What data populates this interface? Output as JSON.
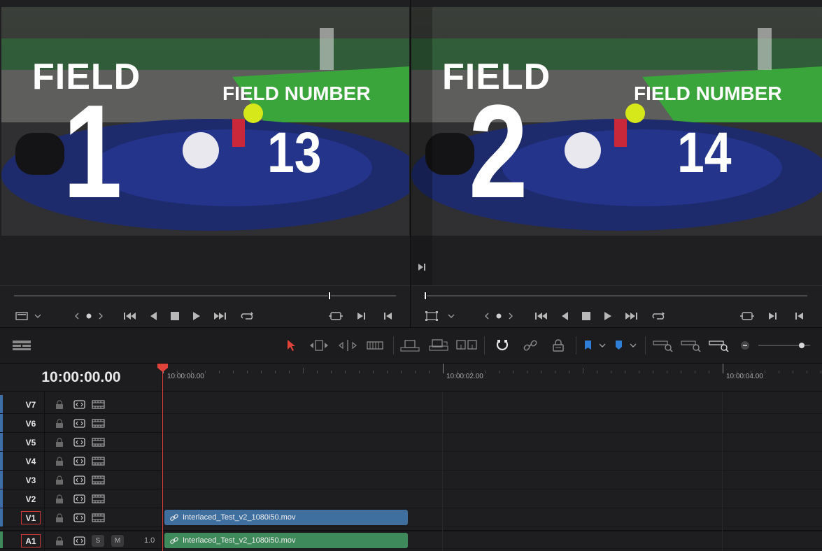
{
  "viewers": [
    {
      "field_word": "FIELD",
      "field_digit": "1",
      "field_number_label": "FIELD NUMBER",
      "field_number_value": "13"
    },
    {
      "field_word": "FIELD",
      "field_digit": "2",
      "field_number_label": "FIELD NUMBER",
      "field_number_value": "14"
    }
  ],
  "timeline": {
    "timecode": "10:00:00.00",
    "ruler_labels": [
      "10:00:00.00",
      "10:00:02.00",
      "10:00:04.00"
    ],
    "video_tracks": [
      "V7",
      "V6",
      "V5",
      "V4",
      "V3",
      "V2",
      "V1"
    ],
    "audio_track": {
      "name": "A1",
      "solo_label": "S",
      "mute_label": "M",
      "volume": "1.0"
    },
    "video_clip": {
      "name": "Interlaced_Test_v2_1080i50.mov",
      "color": "#3f6f9f"
    },
    "audio_clip": {
      "name": "Interlaced_Test_v2_1080i50.mov",
      "color": "#3f8a5a"
    }
  },
  "colors": {
    "playhead": "#e0433b",
    "video_track_accent": "#3d6ea5",
    "audio_track_accent": "#3f8a5a",
    "flag_blue": "#2f7fd8"
  },
  "icons": {
    "viewer_controls": [
      "viewer-options-icon",
      "jog-left-icon",
      "jog-dot-icon",
      "jog-right-icon",
      "go-to-start-icon",
      "play-reverse-icon",
      "stop-icon",
      "play-icon",
      "go-to-end-icon",
      "loop-icon",
      "match-frame-icon",
      "next-edit-icon",
      "prev-edit-icon"
    ],
    "toolbar": [
      "timeline-view-options-icon",
      "selection-tool-icon",
      "trim-tool-icon",
      "dynamic-trim-icon",
      "blade-tool-icon",
      "insert-clip-icon",
      "overwrite-clip-icon",
      "replace-clip-icon",
      "snapping-icon",
      "linked-selection-icon",
      "position-lock-icon",
      "flag-icon",
      "marker-icon",
      "zoom-full-icon",
      "zoom-detail-icon",
      "zoom-custom-icon",
      "zoom-out-icon",
      "zoom-slider"
    ]
  }
}
